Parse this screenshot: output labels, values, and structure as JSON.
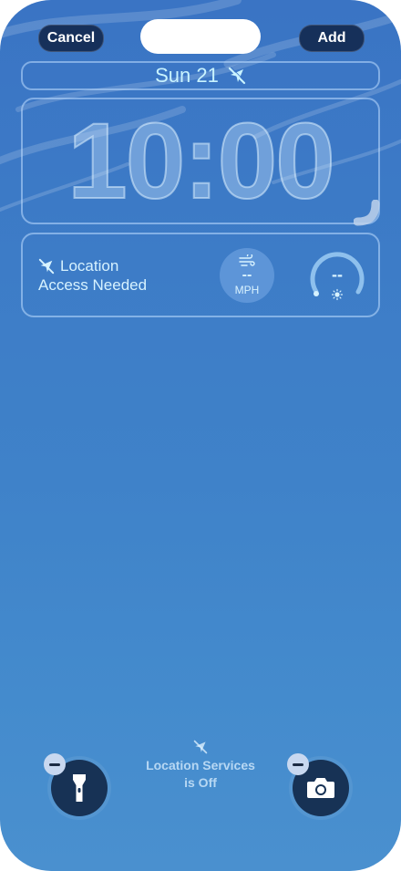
{
  "header": {
    "cancel_label": "Cancel",
    "add_label": "Add"
  },
  "date": {
    "text": "Sun 21",
    "icon": "location-slash-icon"
  },
  "clock": {
    "time": "10:00"
  },
  "widgets": {
    "location_title": "Location",
    "location_subtitle": "Access Needed",
    "wind_value": "--",
    "wind_unit": "MPH",
    "gauge_value": "--"
  },
  "bottom": {
    "location_services_line1": "Location Services",
    "location_services_line2": "is Off",
    "left_icon": "flashlight-icon",
    "right_icon": "camera-icon"
  },
  "colors": {
    "background_top": "#3a74c4",
    "background_bottom": "#4a90cf",
    "accent_text": "#c9f3ff",
    "button_bg": "#16305a"
  }
}
